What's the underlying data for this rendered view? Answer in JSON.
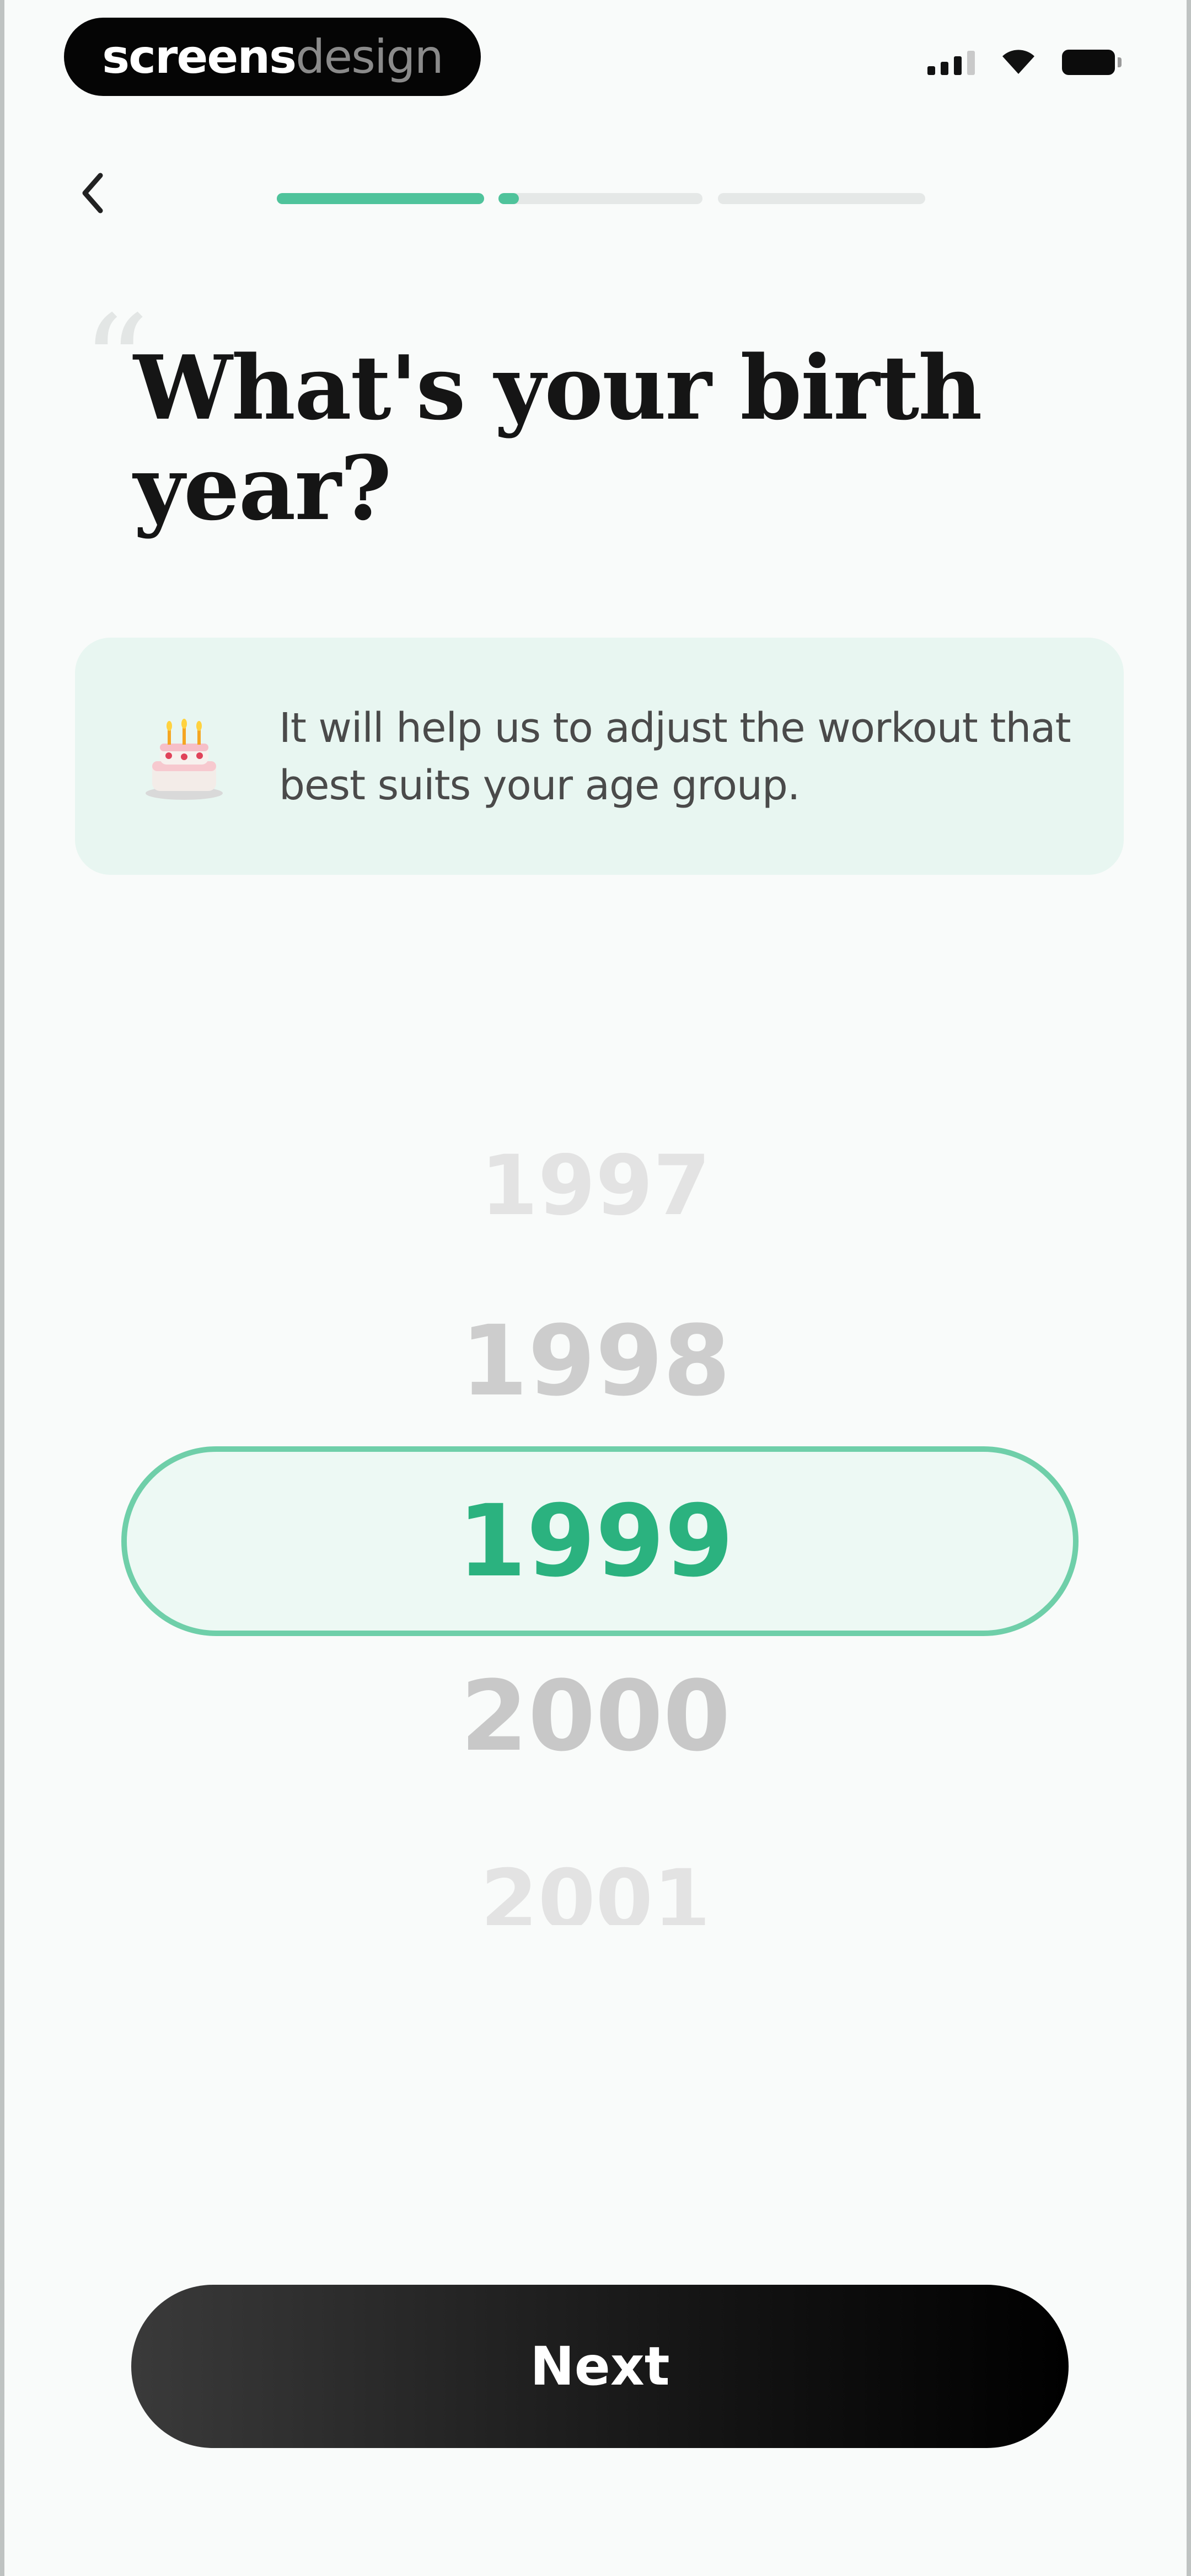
{
  "status_bar": {
    "brand_part1": "screens",
    "brand_part2": "design",
    "icons": [
      "signal-icon",
      "wifi-icon",
      "battery-icon"
    ]
  },
  "nav": {
    "back_icon": "chevron-left-icon",
    "progress_segments": [
      {
        "state": "complete",
        "fill": 1.0
      },
      {
        "state": "current",
        "fill": 0.1
      },
      {
        "state": "upcoming",
        "fill": 0.0
      }
    ]
  },
  "title": "What's your birth year?",
  "info_card": {
    "icon": "birthday-cake-icon",
    "text": "It will help us to adjust the workout that best suits your age group."
  },
  "year_picker": {
    "years_above": [
      "1997",
      "1998"
    ],
    "selected": "1999",
    "years_below": [
      "2000",
      "2001"
    ]
  },
  "next_button": {
    "label": "Next"
  },
  "colors": {
    "accent": "#4fc39b",
    "selected_text": "#2bb27f",
    "card_background": "#e8f6f1",
    "button": "#000000"
  }
}
